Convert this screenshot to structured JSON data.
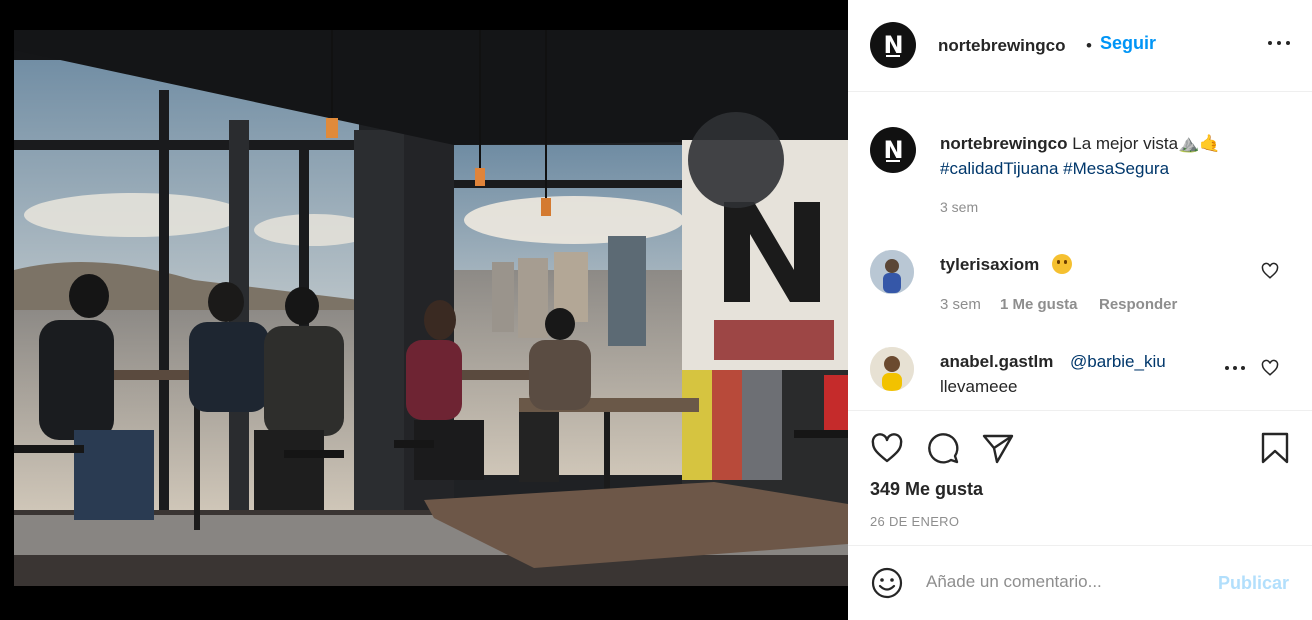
{
  "post": {
    "username": "nortebrewingco",
    "logo_letter": "N",
    "follow_label": "Seguir",
    "dot": "•",
    "caption": {
      "username": "nortebrewingco",
      "text": "La mejor vista⛰️🤙",
      "hashtags": "#calidadTijuana #MesaSegura",
      "time": "3 sem"
    },
    "comments": [
      {
        "username": "tylerisaxiom",
        "time": "3 sem",
        "likes": "1 Me gusta",
        "reply_label": "Responder"
      },
      {
        "username": "anabel.gastlm",
        "mention": "@barbie_kiu",
        "text": "llevameee"
      }
    ],
    "likes": "349 Me gusta",
    "date": "26 DE ENERO",
    "add_comment_placeholder": "Añade un comentario...",
    "publish_label": "Publicar"
  },
  "icons": {
    "more": "more-horizontal-icon",
    "heart": "heart-icon",
    "comment": "comment-icon",
    "share": "share-icon",
    "save": "bookmark-icon",
    "emoji": "emoji-icon"
  },
  "colors": {
    "link_blue": "#0095f6",
    "hashtag": "#00376b",
    "muted": "#8e8e8e",
    "publish_disabled": "#b2dffc"
  }
}
